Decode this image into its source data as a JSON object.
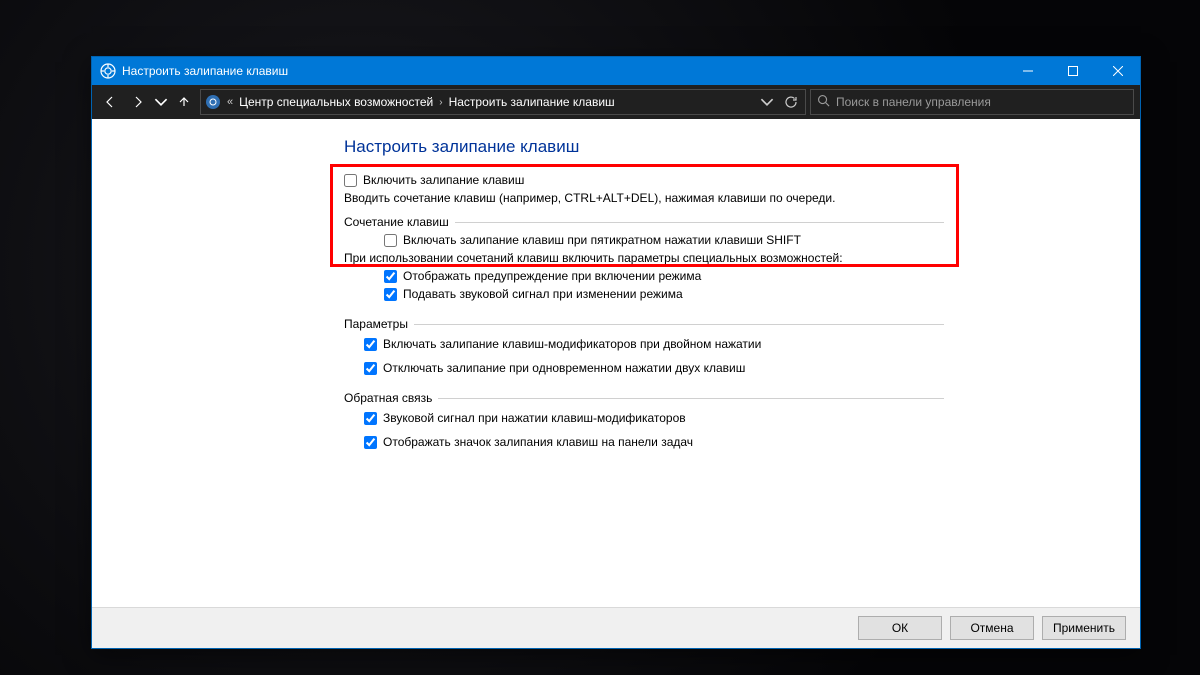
{
  "window": {
    "title": "Настроить залипание клавиш"
  },
  "breadcrumb": {
    "seg1": "Центр специальных возможностей",
    "seg2": "Настроить залипание клавиш"
  },
  "search": {
    "placeholder": "Поиск в панели управления"
  },
  "page": {
    "title": "Настроить залипание клавиш",
    "enable_sticky": "Включить залипание клавиш",
    "enable_sticky_desc": "Вводить сочетание клавиш (например, CTRL+ALT+DEL), нажимая клавиши по очереди.",
    "group_shortcut": "Сочетание клавиш",
    "turn_on_shift5": "Включать залипание клавиш при пятикратном нажатии клавиши SHIFT",
    "when_using_desc": "При использовании сочетаний клавиш включить параметры специальных возможностей:",
    "warn_on_enable": "Отображать предупреждение при включении режима",
    "sound_on_change": "Подавать звуковой сигнал при изменении режима",
    "group_params": "Параметры",
    "lock_on_double": "Включать залипание клавиш-модификаторов при двойном нажатии",
    "turn_off_two": "Отключать залипание при одновременном нажатии двух клавиш",
    "group_feedback": "Обратная связь",
    "sound_on_press": "Звуковой сигнал при нажатии клавиш-модификаторов",
    "tray_icon": "Отображать значок залипания клавиш на панели задач"
  },
  "buttons": {
    "ok": "ОК",
    "cancel": "Отмена",
    "apply": "Применить"
  }
}
